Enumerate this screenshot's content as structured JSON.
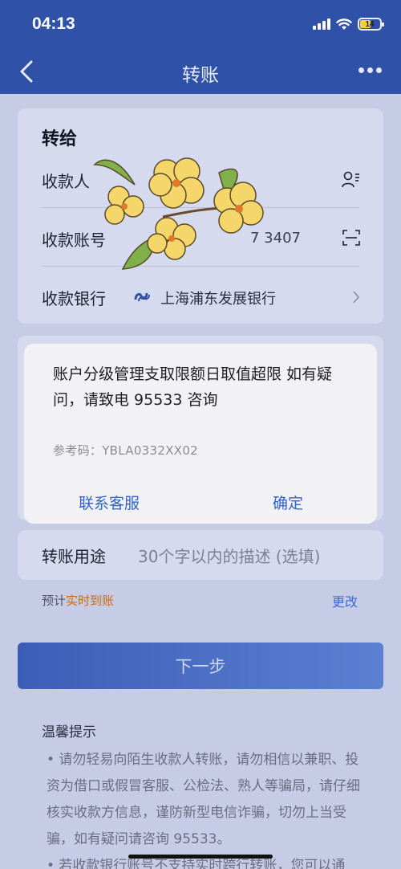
{
  "status_bar": {
    "time": "04:13",
    "battery": "14"
  },
  "navbar": {
    "title": "转账",
    "back_icon": "chevron-left-icon",
    "more_icon": "ellipsis-icon"
  },
  "transfer_card": {
    "title": "转给",
    "payee_label": "收款人",
    "payee_icon": "contacts-icon",
    "account_label": "收款账号",
    "account_value": "7 3407",
    "account_icon": "scan-icon",
    "bank_label": "收款银行",
    "bank_name": "上海浦东发展银行",
    "bank_icon": "spdb-logo-icon"
  },
  "purpose": {
    "label": "转账用途",
    "placeholder": "30个字以内的描述 (选填)"
  },
  "eta": {
    "prefix": "预计",
    "highlight": "实时到账",
    "change_link": "更改"
  },
  "next_button": "下一步",
  "tips": {
    "title": "温馨提示",
    "item1": "• 请勿轻易向陌生收款人转账，请勿相信以兼职、投资为借口或假冒客服、公检法、熟人等骗局，请仔细核实收款方信息，谨防新型电信诈骗，切勿上当受骗，如有疑问请咨询 95533。",
    "item2": "• 若收款银行账号不支持实时跨行转账，您可以通"
  },
  "dialog": {
    "message": "账户分级管理支取限额日取值超限 如有疑问，请致电 95533 咨询",
    "ref_code": "参考码：YBLA0332XX02",
    "left_button": "联系客服",
    "right_button": "确定"
  },
  "colors": {
    "brand_blue": "#2f52a8",
    "link_blue": "#2f63c9",
    "eta_orange": "#c86a14"
  }
}
